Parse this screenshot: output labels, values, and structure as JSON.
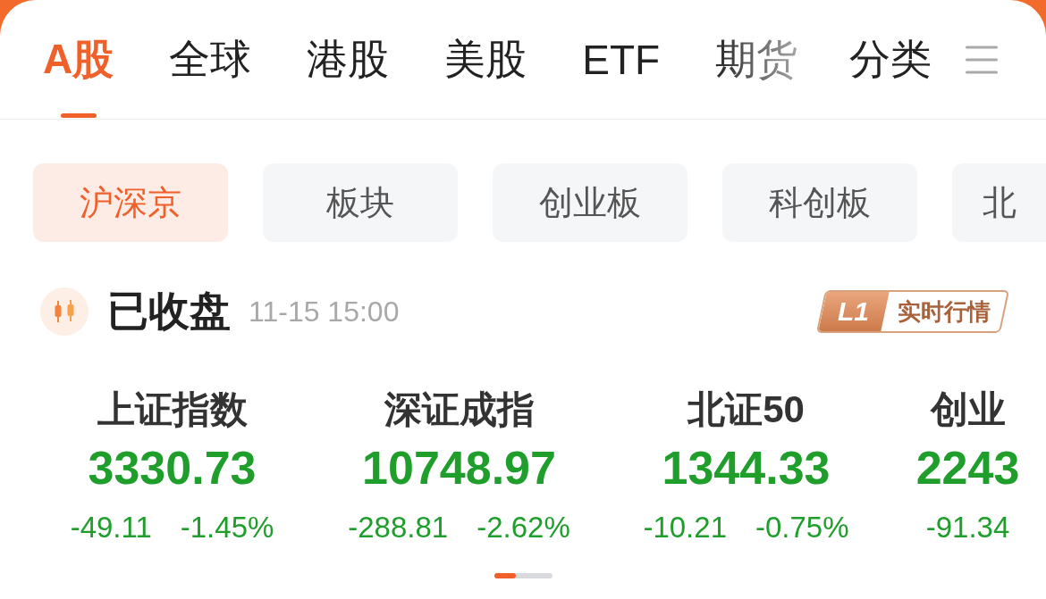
{
  "tabs": [
    {
      "label": "A股",
      "selected": true
    },
    {
      "label": "全球",
      "selected": false
    },
    {
      "label": "港股",
      "selected": false
    },
    {
      "label": "美股",
      "selected": false
    },
    {
      "label": "ETF",
      "selected": false
    },
    {
      "label": "期货",
      "selected": false
    }
  ],
  "category_tab": {
    "label": "分类"
  },
  "market_chips": [
    {
      "label": "沪深京",
      "selected": true
    },
    {
      "label": "板块",
      "selected": false
    },
    {
      "label": "创业板",
      "selected": false
    },
    {
      "label": "科创板",
      "selected": false
    },
    {
      "label": "北",
      "selected": false
    }
  ],
  "market_status": {
    "label": "已收盘",
    "time": "11-15 15:00",
    "badge": {
      "tier": "L1",
      "label": "实时行情"
    }
  },
  "indices": [
    {
      "name": "上证指数",
      "value": "3330.73",
      "change": "-49.11",
      "change_pct": "-1.45%",
      "falling": true
    },
    {
      "name": "深证成指",
      "value": "10748.97",
      "change": "-288.81",
      "change_pct": "-2.62%",
      "falling": true
    },
    {
      "name": "北证50",
      "value": "1344.33",
      "change": "-10.21",
      "change_pct": "-0.75%",
      "falling": true
    },
    {
      "name": "创业",
      "value": "2243",
      "change": "-91.34",
      "falling": true
    }
  ]
}
